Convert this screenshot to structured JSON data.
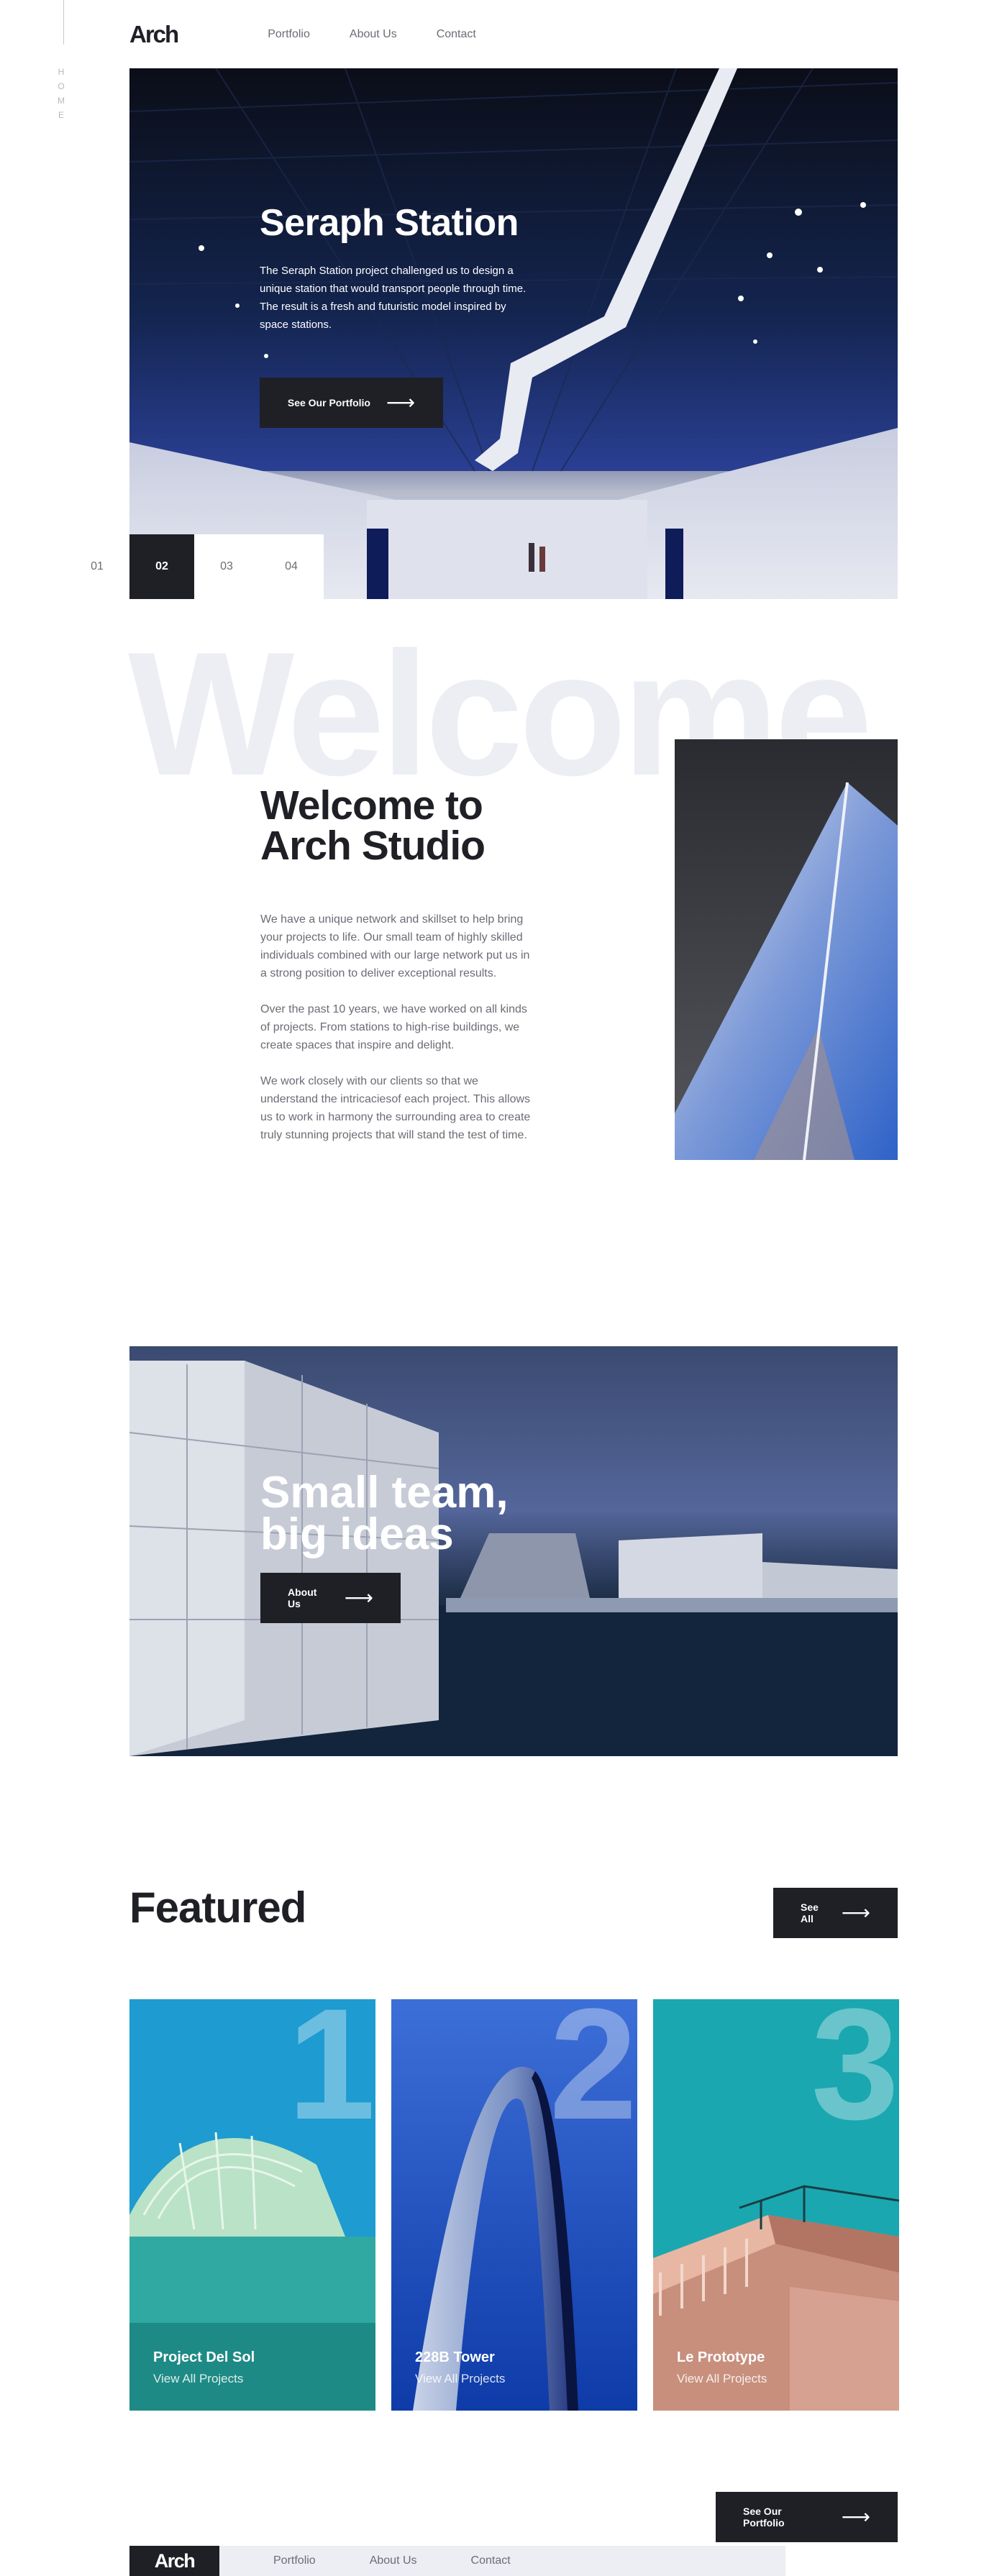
{
  "side": {
    "label": "HOME"
  },
  "header": {
    "logo": "Arch",
    "nav": [
      "Portfolio",
      "About Us",
      "Contact"
    ]
  },
  "hero": {
    "title": "Seraph Station",
    "text": "The Seraph Station project challenged us to design a unique station that would transport people through time. The result is a fresh and futuristic model inspired by space stations.",
    "button": "See Our Portfolio",
    "slides": [
      "01",
      "02",
      "03",
      "04"
    ],
    "active_slide": "02"
  },
  "welcome": {
    "bg_word": "Welcome",
    "title": "Welcome to Arch Studio",
    "paragraphs": [
      "We have a unique network and skillset to help bring your projects to life. Our small team of highly skilled individuals combined with our large network put us in a strong position to deliver exceptional results.",
      "Over the past 10 years, we have worked on all kinds of projects. From stations to high-rise buildings, we create spaces that inspire and delight.",
      "We work closely with our clients so that we understand the intricaciesof each project. This allows us to work in harmony the surrounding area to create truly stunning projects that will stand the test of time."
    ]
  },
  "team": {
    "title": "Small team, big ideas",
    "button": "About Us"
  },
  "featured": {
    "title": "Featured",
    "button": "See All",
    "cards": [
      {
        "num": "1",
        "title": "Project Del Sol",
        "link": "View All Projects"
      },
      {
        "num": "2",
        "title": "228B Tower",
        "link": "View All Projects"
      },
      {
        "num": "3",
        "title": "Le Prototype",
        "link": "View All Projects"
      }
    ]
  },
  "footer": {
    "logo": "Arch",
    "nav": [
      "Portfolio",
      "About Us",
      "Contact"
    ],
    "button": "See Our Portfolio"
  },
  "icons": {
    "arrow": "arrow-right-icon"
  },
  "colors": {
    "dark": "#1f1f26",
    "grey_text": "#6b6d75",
    "light_bg": "#eceef3",
    "white": "#ffffff"
  }
}
